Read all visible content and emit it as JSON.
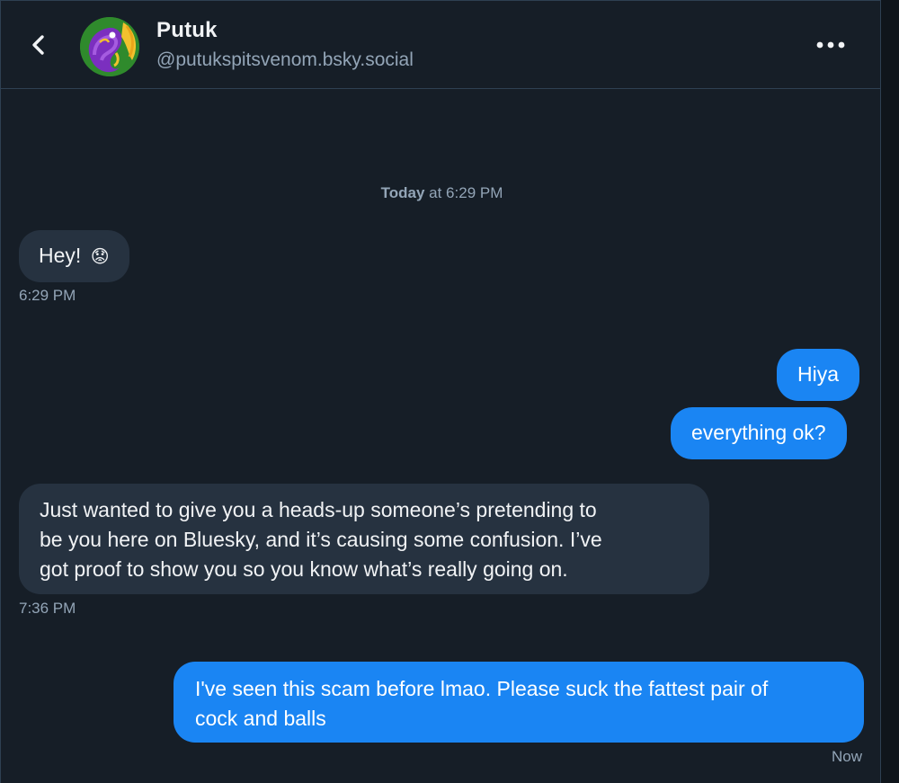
{
  "conversation": {
    "name": "Putuk",
    "handle": "@putukspitsvenom.bsky.social"
  },
  "icons": {
    "back": "chevron-left-icon",
    "more": "more-horizontal-icon",
    "avatar": "avatar-illustration"
  },
  "colors": {
    "background": "#161e27",
    "incoming_bubble": "#263240",
    "outgoing_bubble": "#1a85f3",
    "muted_text": "#93a5b7",
    "divider": "#2e4052"
  },
  "date_separator": {
    "day": "Today",
    "rest": " at 6:29 PM"
  },
  "messages": [
    {
      "direction": "incoming",
      "text": "Hey!",
      "emoji": "😟"
    },
    {
      "direction": "incoming",
      "meta": "6:29 PM"
    },
    {
      "direction": "outgoing",
      "text": "Hiya"
    },
    {
      "direction": "outgoing",
      "text": "everything ok?"
    },
    {
      "direction": "incoming",
      "lines": [
        "Just wanted to give you a heads-up someone’s pretending to",
        "be you here on Bluesky, and it’s causing some confusion. I’ve",
        "got proof to show you so you know what’s really going on."
      ],
      "meta": "7:36 PM"
    },
    {
      "direction": "outgoing",
      "lines": [
        "I've seen this scam before lmao. Please suck the fattest pair of",
        "cock and balls"
      ],
      "meta": "Now"
    }
  ]
}
